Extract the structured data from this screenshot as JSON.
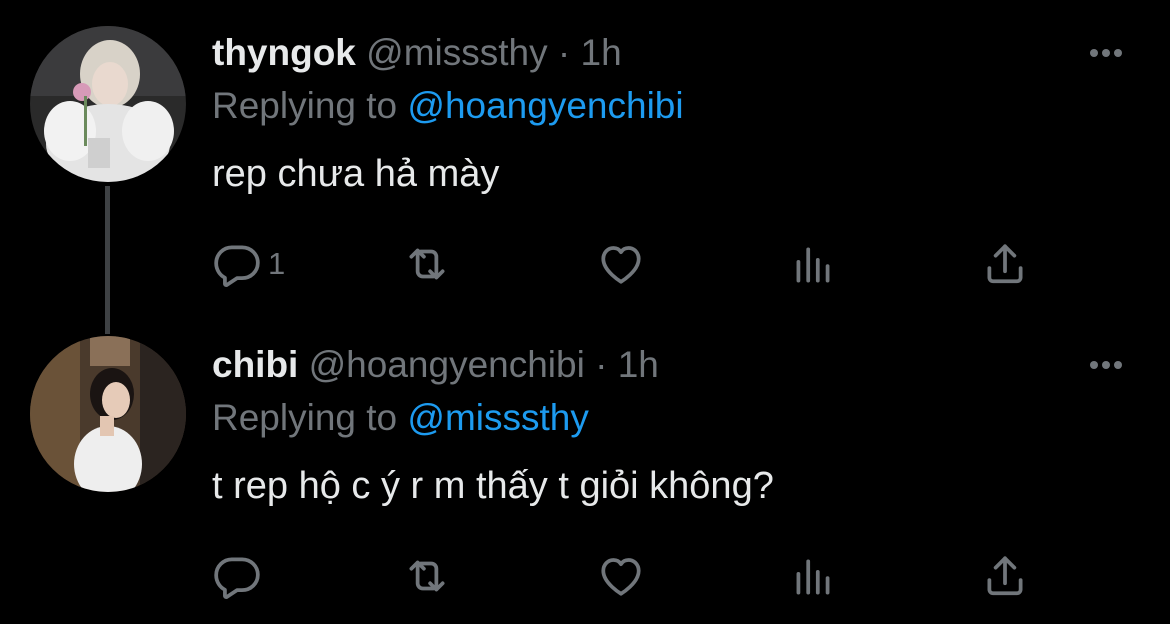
{
  "tweets": [
    {
      "display_name": "thyngok",
      "handle": "@misssthy",
      "separator": "·",
      "time": "1h",
      "replying_prefix": "Replying to",
      "replying_to": "@hoangyenchibi",
      "text": "rep chưa hả mày",
      "reply_count": "1",
      "icons": [
        "reply-icon",
        "retweet-icon",
        "like-icon",
        "views-icon",
        "share-icon",
        "more-icon"
      ]
    },
    {
      "display_name": "chibi",
      "handle": "@hoangyenchibi",
      "separator": "·",
      "time": "1h",
      "replying_prefix": "Replying to",
      "replying_to": "@misssthy",
      "text": "t rep hộ c ý r m thấy t giỏi không?",
      "reply_count": "",
      "icons": [
        "reply-icon",
        "retweet-icon",
        "like-icon",
        "views-icon",
        "share-icon",
        "more-icon"
      ]
    }
  ],
  "colors": {
    "background": "#000000",
    "primary_text": "#e7e9ea",
    "secondary_text": "#71767b",
    "accent": "#1d9bf0",
    "thread_line": "#3e4144"
  }
}
